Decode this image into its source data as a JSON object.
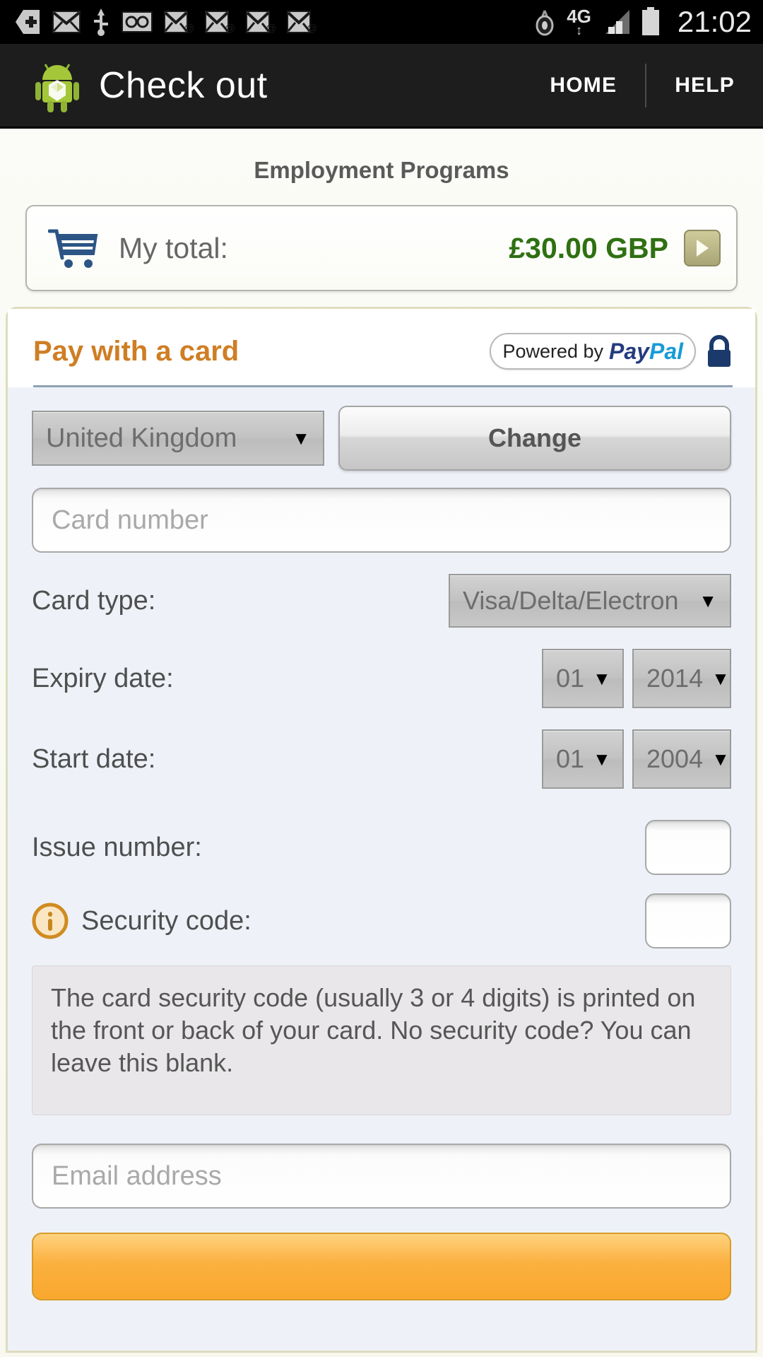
{
  "statusbar": {
    "time": "21:02",
    "network_label": "4G",
    "icons": [
      "add-call-icon",
      "message-icon",
      "usb-icon",
      "voicemail-icon",
      "email-icon",
      "email-icon",
      "email-icon",
      "email-icon",
      "eye-icon",
      "network-4g-icon",
      "signal-icon",
      "battery-icon"
    ]
  },
  "actionbar": {
    "logo": "android-robot-icon",
    "title": "Check out",
    "home_label": "HOME",
    "help_label": "HELP"
  },
  "page": {
    "title": "Employment Programs"
  },
  "total": {
    "cart_icon": "shopping-cart-icon",
    "label": "My total:",
    "amount": "£30.00 GBP",
    "arrow_icon": "play-arrow-icon"
  },
  "paypal_panel": {
    "heading": "Pay with a card",
    "badge_prefix": "Powered by",
    "badge_pay": "Pay",
    "badge_pal": "Pal",
    "lock_icon": "lock-icon"
  },
  "form": {
    "country": {
      "name": "country-select",
      "value": "United Kingdom",
      "caret": "▼"
    },
    "change_button": "Change",
    "card_number_placeholder": "Card number",
    "card_type": {
      "label": "Card type:",
      "value": "Visa/Delta/Electron",
      "caret": "▼"
    },
    "expiry": {
      "label": "Expiry date:",
      "month": "01",
      "year": "2014",
      "caret": "▼"
    },
    "start": {
      "label": "Start date:",
      "month": "01",
      "year": "2004",
      "caret": "▼"
    },
    "issue_number": {
      "label": "Issue number:",
      "value": ""
    },
    "security_code": {
      "icon": "info-icon",
      "label": "Security code:",
      "value": "",
      "help_text": "The card security code (usually 3 or 4 digits) is printed on the front or back of your card. No security code? You can leave this blank."
    },
    "email_placeholder": "Email address"
  },
  "colors": {
    "accent_orange": "#cf7e24",
    "total_green": "#2f7012",
    "paypal_dark": "#253b80",
    "paypal_light": "#179bd7",
    "submit_button": "#f9a82e"
  }
}
